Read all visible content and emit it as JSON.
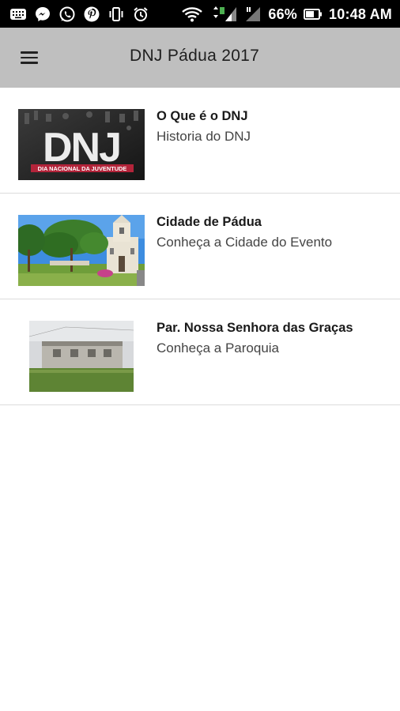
{
  "status_bar": {
    "battery": "66%",
    "time": "10:48 AM",
    "left_icons": [
      "keyboard-icon",
      "messenger-icon",
      "whatsapp-icon",
      "pinterest-icon",
      "vibrate-icon",
      "alarm-icon"
    ],
    "right_icons": [
      "wifi-icon",
      "signal-icon",
      "signal-icon",
      "battery-icon"
    ]
  },
  "app_bar": {
    "title": "DNJ Pádua 2017",
    "menu_icon": "hamburger-menu-icon"
  },
  "list": [
    {
      "title": "O Que é o DNJ",
      "subtitle": "Historia do DNJ",
      "image_text": "DNJ",
      "image_caption": "DIA NACIONAL DA JUVENTUDE"
    },
    {
      "title": "Cidade de Pádua",
      "subtitle": "Conheça a Cidade do Evento"
    },
    {
      "title": "Par. Nossa Senhora das Graças",
      "subtitle": "Conheça a Paroquia"
    }
  ],
  "colors": {
    "status_bar": "#000000",
    "app_bar": "#bfbfbf",
    "background": "#ffffff",
    "divider": "#dcdcdc",
    "title_text": "#1a1a1a",
    "subtitle_text": "#444444"
  }
}
